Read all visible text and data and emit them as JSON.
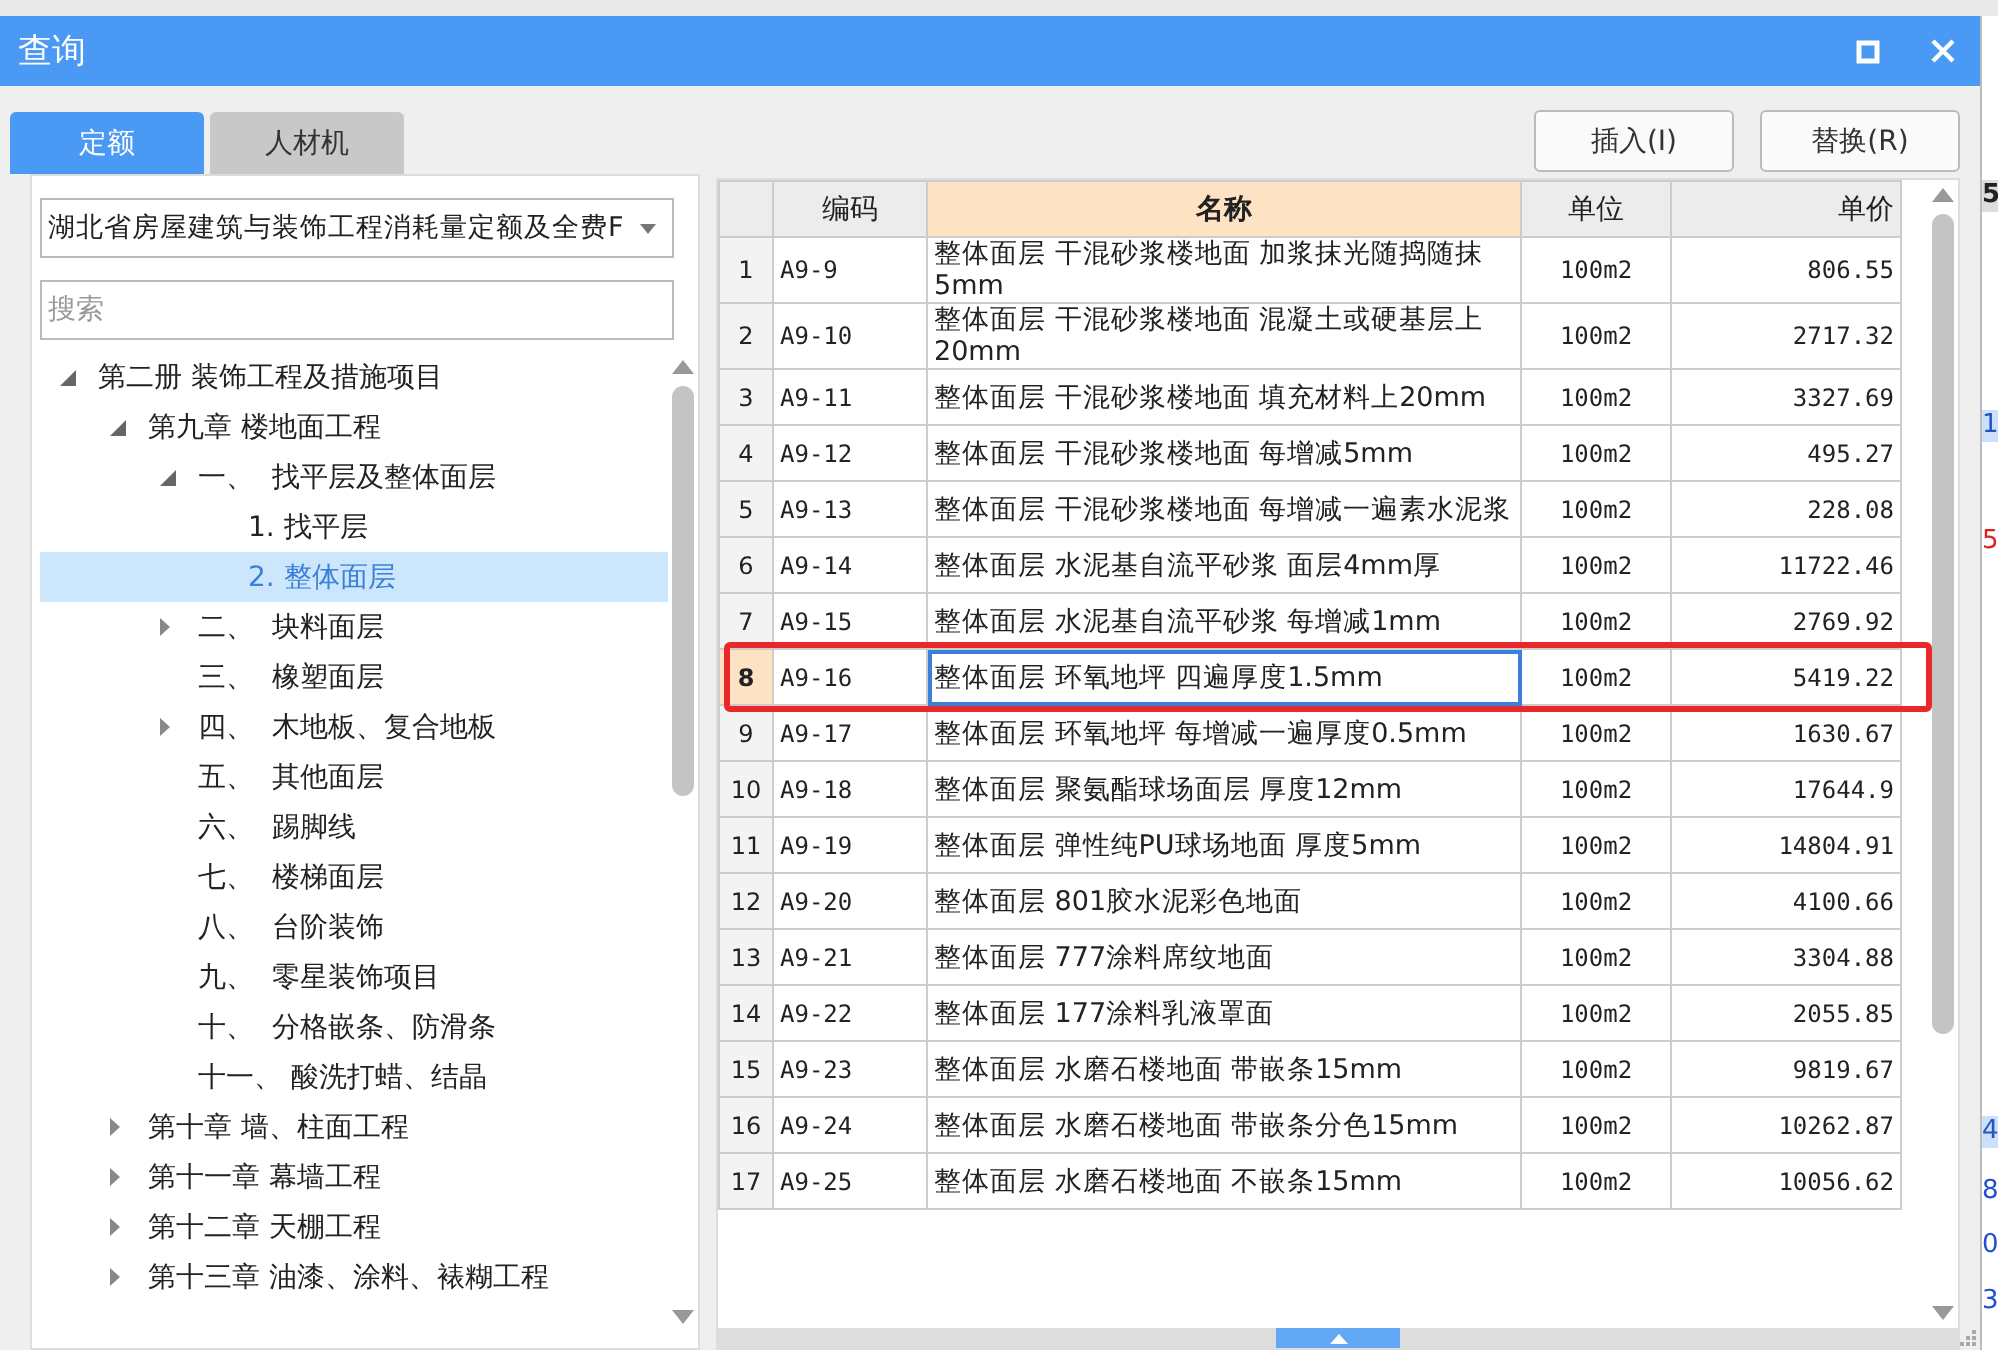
{
  "window": {
    "title": "查询"
  },
  "tabs": [
    {
      "label": "定额",
      "selected": true
    },
    {
      "label": "人材机",
      "selected": false
    }
  ],
  "buttons": [
    {
      "label": "插入(I)"
    },
    {
      "label": "替换(R)"
    }
  ],
  "library_dropdown": {
    "value": "湖北省房屋建筑与装饰工程消耗量定额及全费F"
  },
  "search": {
    "placeholder": "搜索"
  },
  "tree": [
    {
      "label": "第二册 装饰工程及措施项目",
      "expanded": true,
      "selected": false,
      "children": [
        {
          "label": "第九章 楼地面工程",
          "expanded": true,
          "selected": false,
          "children": [
            {
              "label": "一、  找平层及整体面层",
              "expanded": true,
              "selected": false,
              "children": [
                {
                  "label": "1. 找平层",
                  "selected": false
                },
                {
                  "label": "2. 整体面层",
                  "selected": true
                }
              ]
            },
            {
              "label": "二、  块料面层",
              "expanded": false,
              "selected": false
            },
            {
              "label": "三、  橡塑面层",
              "selected": false
            },
            {
              "label": "四、  木地板、复合地板",
              "expanded": false,
              "selected": false
            },
            {
              "label": "五、  其他面层",
              "selected": false
            },
            {
              "label": "六、  踢脚线",
              "selected": false
            },
            {
              "label": "七、  楼梯面层",
              "selected": false
            },
            {
              "label": "八、  台阶装饰",
              "selected": false
            },
            {
              "label": "九、  零星装饰项目",
              "selected": false
            },
            {
              "label": "十、  分格嵌条、防滑条",
              "selected": false
            },
            {
              "label": "十一、 酸洗打蜡、结晶",
              "selected": false
            }
          ]
        },
        {
          "label": "第十章 墙、柱面工程",
          "expanded": false,
          "selected": false
        },
        {
          "label": "第十一章 幕墙工程",
          "expanded": false,
          "selected": false
        },
        {
          "label": "第十二章 天棚工程",
          "expanded": false,
          "selected": false
        },
        {
          "label": "第十三章 油漆、涂料、裱糊工程",
          "expanded": false,
          "selected": false
        }
      ]
    }
  ],
  "table": {
    "columns": [
      {
        "label": "编码",
        "sorted": false
      },
      {
        "label": "名称",
        "sorted": true
      },
      {
        "label": "单位",
        "sorted": false
      },
      {
        "label": "单价",
        "sorted": false
      }
    ],
    "rows": [
      {
        "no": "1",
        "code": "A9-9",
        "name": "整体面层 干混砂浆楼地面 加浆抹光随捣随抹5mm",
        "unit": "100m2",
        "price": "806.55",
        "selected": false,
        "outlined": false
      },
      {
        "no": "2",
        "code": "A9-10",
        "name": "整体面层 干混砂浆楼地面 混凝土或硬基层上20mm",
        "unit": "100m2",
        "price": "2717.32",
        "selected": false,
        "outlined": false
      },
      {
        "no": "3",
        "code": "A9-11",
        "name": "整体面层 干混砂浆楼地面 填充材料上20mm",
        "unit": "100m2",
        "price": "3327.69",
        "selected": false,
        "outlined": false
      },
      {
        "no": "4",
        "code": "A9-12",
        "name": "整体面层 干混砂浆楼地面 每增减5mm",
        "unit": "100m2",
        "price": "495.27",
        "selected": false,
        "outlined": false
      },
      {
        "no": "5",
        "code": "A9-13",
        "name": "整体面层 干混砂浆楼地面 每增减一遍素水泥浆",
        "unit": "100m2",
        "price": "228.08",
        "selected": false,
        "outlined": false
      },
      {
        "no": "6",
        "code": "A9-14",
        "name": "整体面层 水泥基自流平砂浆 面层4mm厚",
        "unit": "100m2",
        "price": "11722.46",
        "selected": false,
        "outlined": false
      },
      {
        "no": "7",
        "code": "A9-15",
        "name": "整体面层 水泥基自流平砂浆 每增减1mm",
        "unit": "100m2",
        "price": "2769.92",
        "selected": false,
        "outlined": false
      },
      {
        "no": "8",
        "code": "A9-16",
        "name": "整体面层 环氧地坪 四遍厚度1.5mm",
        "unit": "100m2",
        "price": "5419.22",
        "selected": true,
        "outlined": true
      },
      {
        "no": "9",
        "code": "A9-17",
        "name": "整体面层 环氧地坪 每增减一遍厚度0.5mm",
        "unit": "100m2",
        "price": "1630.67",
        "selected": false,
        "outlined": false
      },
      {
        "no": "10",
        "code": "A9-18",
        "name": "整体面层 聚氨酯球场面层 厚度12mm",
        "unit": "100m2",
        "price": "17644.9",
        "selected": false,
        "outlined": false
      },
      {
        "no": "11",
        "code": "A9-19",
        "name": "整体面层 弹性纯PU球场地面 厚度5mm",
        "unit": "100m2",
        "price": "14804.91",
        "selected": false,
        "outlined": false
      },
      {
        "no": "12",
        "code": "A9-20",
        "name": "整体面层 801胶水泥彩色地面",
        "unit": "100m2",
        "price": "4100.66",
        "selected": false,
        "outlined": false
      },
      {
        "no": "13",
        "code": "A9-21",
        "name": "整体面层 777涂料席纹地面",
        "unit": "100m2",
        "price": "3304.88",
        "selected": false,
        "outlined": false
      },
      {
        "no": "14",
        "code": "A9-22",
        "name": "整体面层 177涂料乳液罩面",
        "unit": "100m2",
        "price": "2055.85",
        "selected": false,
        "outlined": false
      },
      {
        "no": "15",
        "code": "A9-23",
        "name": "整体面层 水磨石楼地面 带嵌条15mm",
        "unit": "100m2",
        "price": "9819.67",
        "selected": false,
        "outlined": false
      },
      {
        "no": "16",
        "code": "A9-24",
        "name": "整体面层 水磨石楼地面 带嵌条分色15mm",
        "unit": "100m2",
        "price": "10262.87",
        "selected": false,
        "outlined": false
      },
      {
        "no": "17",
        "code": "A9-25",
        "name": "整体面层 水磨石楼地面 不嵌条15mm",
        "unit": "100m2",
        "price": "10056.62",
        "selected": false,
        "outlined": false
      }
    ]
  },
  "background_window": {
    "fragments": [
      {
        "text": "5",
        "kind": "header"
      },
      {
        "text": "1",
        "kind": "highlight"
      },
      {
        "text": "5",
        "kind": "red"
      },
      {
        "text": "4",
        "kind": "highlight"
      },
      {
        "text": "8",
        "kind": "blue"
      },
      {
        "text": "0",
        "kind": "blue"
      },
      {
        "text": "3",
        "kind": "blue"
      }
    ]
  }
}
